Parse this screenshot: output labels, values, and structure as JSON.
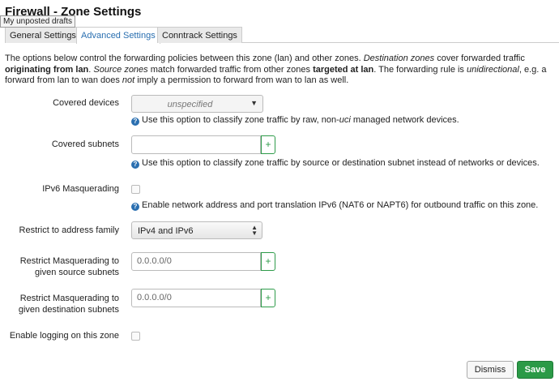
{
  "page": {
    "title": "Firewall - Zone Settings",
    "tooltip": "My unposted drafts"
  },
  "tabs": [
    {
      "label": "General Settings",
      "active": false
    },
    {
      "label": "Advanced Settings",
      "active": true
    },
    {
      "label": "Conntrack Settings",
      "active": false
    }
  ],
  "intro": {
    "p1": "The options below control the forwarding policies between this zone (lan) and other zones. ",
    "p2": "Destination zones",
    "p3": " cover forwarded traffic ",
    "p4": "originating from lan",
    "p5": ". ",
    "p6": "Source zones",
    "p7": " match forwarded traffic from other zones ",
    "p8": "targeted at lan",
    "p9": ". The forwarding rule is ",
    "p10": "unidirectional",
    "p11": ", e.g. a forward from lan to wan does ",
    "p12": "not",
    "p13": " imply a permission to forward from wan to lan as well."
  },
  "fields": {
    "covered_devices": {
      "label": "Covered devices",
      "value": "unspecified",
      "help_a": "Use this option to classify zone traffic by raw, non-",
      "help_b": "uci",
      "help_c": " managed network devices."
    },
    "covered_subnets": {
      "label": "Covered subnets",
      "value": "",
      "help": "Use this option to classify zone traffic by source or destination subnet instead of networks or devices."
    },
    "ipv6_masq": {
      "label": "IPv6 Masquerading",
      "checked": false,
      "help": "Enable network address and port translation IPv6 (NAT6 or NAPT6) for outbound traffic on this zone."
    },
    "address_family": {
      "label": "Restrict to address family",
      "value": "IPv4 and IPv6"
    },
    "masq_src": {
      "label_1": "Restrict Masquerading to",
      "label_2": "given source subnets",
      "placeholder": "0.0.0.0/0"
    },
    "masq_dest": {
      "label_1": "Restrict Masquerading to",
      "label_2": "given destination subnets",
      "placeholder": "0.0.0.0/0"
    },
    "logging": {
      "label": "Enable logging on this zone",
      "checked": false
    }
  },
  "buttons": {
    "dismiss": "Dismiss",
    "save": "Save"
  },
  "icons": {
    "help": "help-icon",
    "add": "plus-icon",
    "dropdown": "caret-down-icon"
  },
  "colors": {
    "accent": "#2a6fb0",
    "save": "#2b9a47",
    "add": "#2e9b4a"
  }
}
